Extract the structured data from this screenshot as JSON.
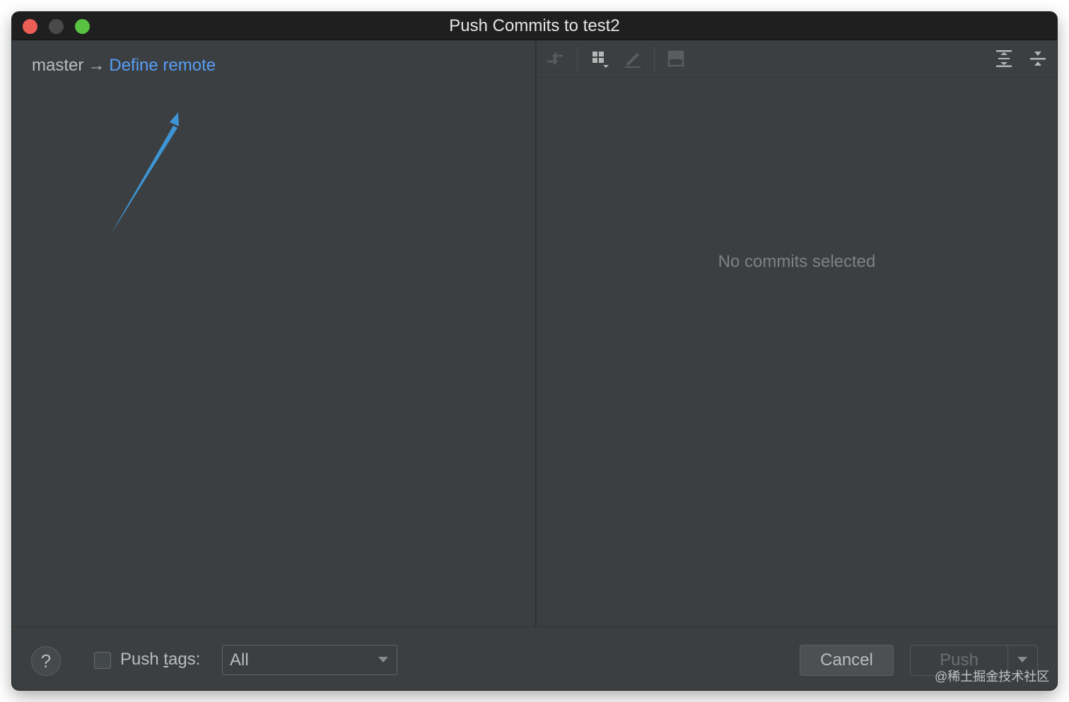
{
  "window": {
    "title": "Push Commits to test2"
  },
  "left_pane": {
    "branch": "master",
    "arrow": "→",
    "remote_link": "Define remote"
  },
  "right_pane": {
    "toolbar": {
      "icons": [
        "push-back-icon",
        "group-by-icon",
        "edit-icon",
        "preview-icon",
        "expand-all-icon",
        "collapse-all-icon"
      ]
    },
    "empty_text": "No commits selected"
  },
  "footer": {
    "help_label": "?",
    "push_tags_checked": false,
    "push_tags_label_prefix": "Push ",
    "push_tags_label_mnemonic": "t",
    "push_tags_label_suffix": "ags:",
    "push_tags_value": "All",
    "cancel_label": "Cancel",
    "push_label": "Push",
    "watermark": "@稀土掘金技术社区"
  },
  "colors": {
    "background": "#3c3f41",
    "link": "#589df6",
    "annotation_arrow": "#3d95d5",
    "close": "#ec5f57",
    "minimize": "#4a4a4a",
    "maximize": "#58c241"
  }
}
